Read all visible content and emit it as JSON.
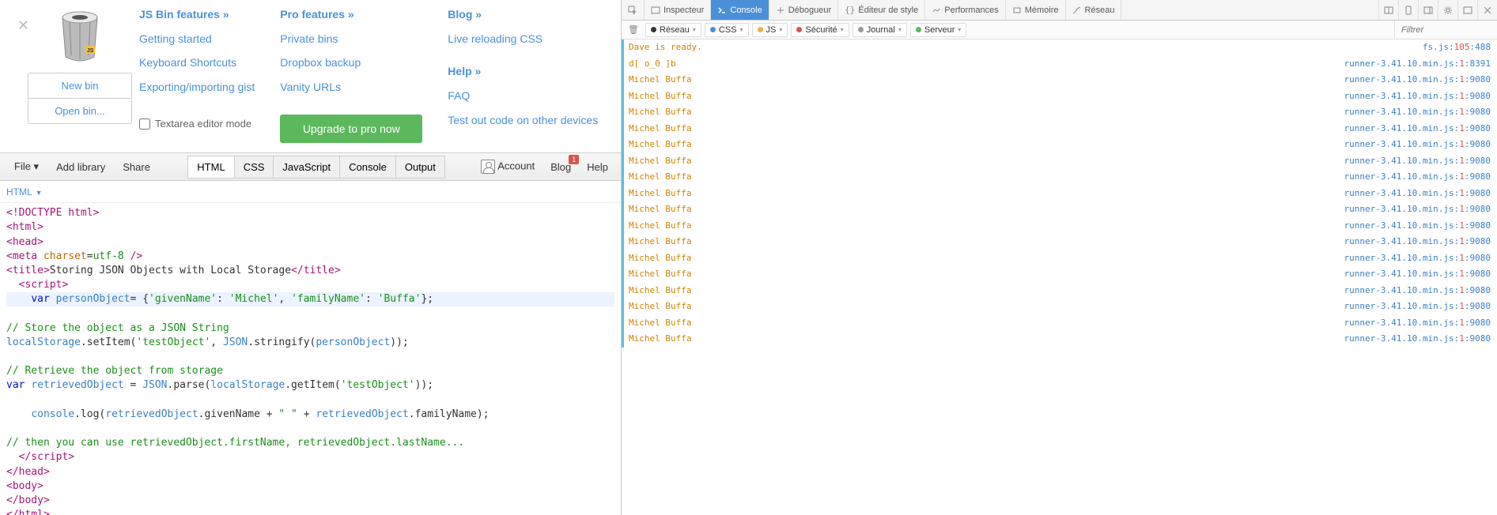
{
  "jsbin": {
    "buttons": {
      "new_bin": "New bin",
      "open_bin": "Open bin..."
    },
    "col1": {
      "head": "JS Bin features »",
      "items": [
        "Getting started",
        "Keyboard Shortcuts",
        "Exporting/importing gist"
      ],
      "textarea_mode": "Textarea editor mode"
    },
    "col2": {
      "head": "Pro features »",
      "items": [
        "Private bins",
        "Dropbox backup",
        "Vanity URLs"
      ],
      "upgrade": "Upgrade to pro now"
    },
    "col3": {
      "blog_head": "Blog »",
      "blog_item": "Live reloading CSS",
      "help_head": "Help »",
      "help_items": [
        "FAQ",
        "Test out code on other devices"
      ]
    }
  },
  "toolbar": {
    "file": "File ▾",
    "add_library": "Add library",
    "share": "Share",
    "tabs": [
      "HTML",
      "CSS",
      "JavaScript",
      "Console",
      "Output"
    ],
    "active_tab": "HTML",
    "account": "Account",
    "blog": "Blog",
    "blog_badge": "1",
    "help": "Help"
  },
  "editor": {
    "lang_label": "HTML",
    "title_text": "Storing JSON Objects with Local Storage"
  },
  "devtools": {
    "tabs": {
      "inspecteur": "Inspecteur",
      "console": "Console",
      "debogueur": "Débogueur",
      "editeur_style": "Éditeur de style",
      "performances": "Performances",
      "memoire": "Mémoire",
      "reseau": "Réseau"
    },
    "filters": {
      "reseau": "Réseau",
      "css": "CSS",
      "js": "JS",
      "securite": "Sécurité",
      "journal": "Journal",
      "serveur": "Serveur"
    },
    "filter_placeholder": "Filtrer",
    "logs": [
      {
        "msg": "Dave is ready.",
        "src": "fs.js",
        "line": "105",
        "col": "488",
        "type": "info"
      },
      {
        "msg": "d[ o_0 ]b",
        "src": "runner-3.41.10.min.js",
        "line": "1",
        "col": "8391",
        "type": "info"
      },
      {
        "msg": "Michel Buffa",
        "src": "runner-3.41.10.min.js",
        "line": "1",
        "col": "9080",
        "type": "info"
      },
      {
        "msg": "Michel Buffa",
        "src": "runner-3.41.10.min.js",
        "line": "1",
        "col": "9080",
        "type": "info"
      },
      {
        "msg": "Michel Buffa",
        "src": "runner-3.41.10.min.js",
        "line": "1",
        "col": "9080",
        "type": "info"
      },
      {
        "msg": "Michel Buffa",
        "src": "runner-3.41.10.min.js",
        "line": "1",
        "col": "9080",
        "type": "info"
      },
      {
        "msg": "Michel Buffa",
        "src": "runner-3.41.10.min.js",
        "line": "1",
        "col": "9080",
        "type": "info"
      },
      {
        "msg": "Michel Buffa",
        "src": "runner-3.41.10.min.js",
        "line": "1",
        "col": "9080",
        "type": "info"
      },
      {
        "msg": "Michel Buffa",
        "src": "runner-3.41.10.min.js",
        "line": "1",
        "col": "9080",
        "type": "info"
      },
      {
        "msg": "Michel Buffa",
        "src": "runner-3.41.10.min.js",
        "line": "1",
        "col": "9080",
        "type": "info"
      },
      {
        "msg": "Michel Buffa",
        "src": "runner-3.41.10.min.js",
        "line": "1",
        "col": "9080",
        "type": "info"
      },
      {
        "msg": "Michel Buffa",
        "src": "runner-3.41.10.min.js",
        "line": "1",
        "col": "9080",
        "type": "info"
      },
      {
        "msg": "Michel Buffa",
        "src": "runner-3.41.10.min.js",
        "line": "1",
        "col": "9080",
        "type": "info"
      },
      {
        "msg": "Michel Buffa",
        "src": "runner-3.41.10.min.js",
        "line": "1",
        "col": "9080",
        "type": "info"
      },
      {
        "msg": "Michel Buffa",
        "src": "runner-3.41.10.min.js",
        "line": "1",
        "col": "9080",
        "type": "info"
      },
      {
        "msg": "Michel Buffa",
        "src": "runner-3.41.10.min.js",
        "line": "1",
        "col": "9080",
        "type": "info"
      },
      {
        "msg": "Michel Buffa",
        "src": "runner-3.41.10.min.js",
        "line": "1",
        "col": "9080",
        "type": "info"
      },
      {
        "msg": "Michel Buffa",
        "src": "runner-3.41.10.min.js",
        "line": "1",
        "col": "9080",
        "type": "info"
      },
      {
        "msg": "Michel Buffa",
        "src": "runner-3.41.10.min.js",
        "line": "1",
        "col": "9080",
        "type": "info"
      }
    ]
  }
}
